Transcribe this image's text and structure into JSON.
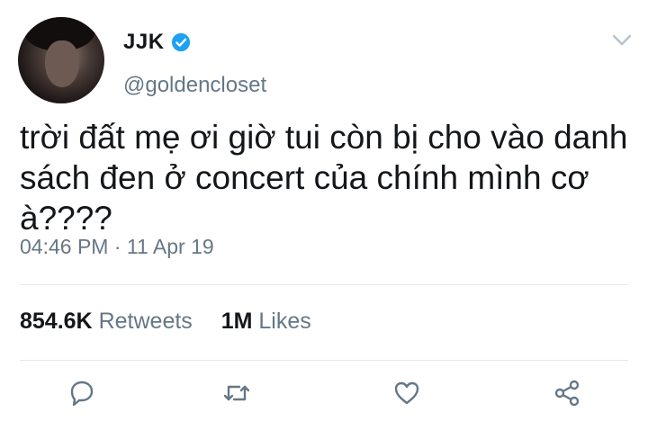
{
  "author": {
    "name": "JJK",
    "handle": "@goldencloset",
    "verified": true
  },
  "tweet": {
    "text": "trời đất mẹ ơi giờ tui còn bị cho vào danh sách đen ở concert của chính mình cơ à????",
    "time": "04:46 PM",
    "separator": "·",
    "date": "11 Apr 19"
  },
  "stats": {
    "retweets_count": "854.6K",
    "retweets_label": "Retweets",
    "likes_count": "1M",
    "likes_label": "Likes"
  },
  "actions": [
    "reply-icon",
    "retweet-icon",
    "like-icon",
    "share-icon"
  ],
  "colors": {
    "text": "#14171a",
    "secondary": "#657786",
    "verified": "#1da1f2",
    "icons": "#657786",
    "divider": "#e1e8ed"
  }
}
